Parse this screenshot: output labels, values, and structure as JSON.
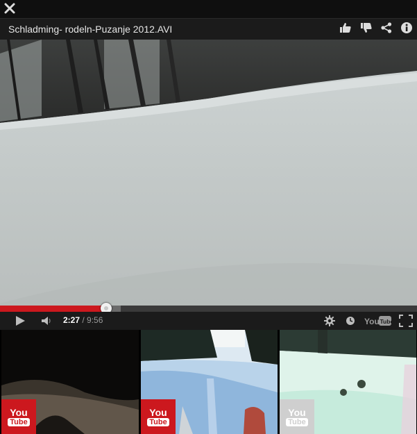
{
  "window": {
    "close_label": "Close"
  },
  "video": {
    "title": "Schladming- rodeln-Puzanje 2012.AVI",
    "actions": [
      "thumb-up-icon",
      "thumb-down-icon",
      "share-icon",
      "info-icon"
    ]
  },
  "player": {
    "current_time": "2:27",
    "separator": " / ",
    "duration": "9:56",
    "played_fraction": 0.255,
    "loaded_fraction": 0.29,
    "brand": "YouTube",
    "colors": {
      "played": "#cc181e",
      "bar": "#1b1b1b"
    }
  },
  "related": [
    {
      "badge_you": "You",
      "badge_tube": "Tube",
      "badge_color": "#cc181e"
    },
    {
      "badge_you": "You",
      "badge_tube": "Tube",
      "badge_color": "#cc181e"
    },
    {
      "badge_you": "You",
      "badge_tube": "Tube",
      "badge_color": "#cfcfcf"
    }
  ]
}
